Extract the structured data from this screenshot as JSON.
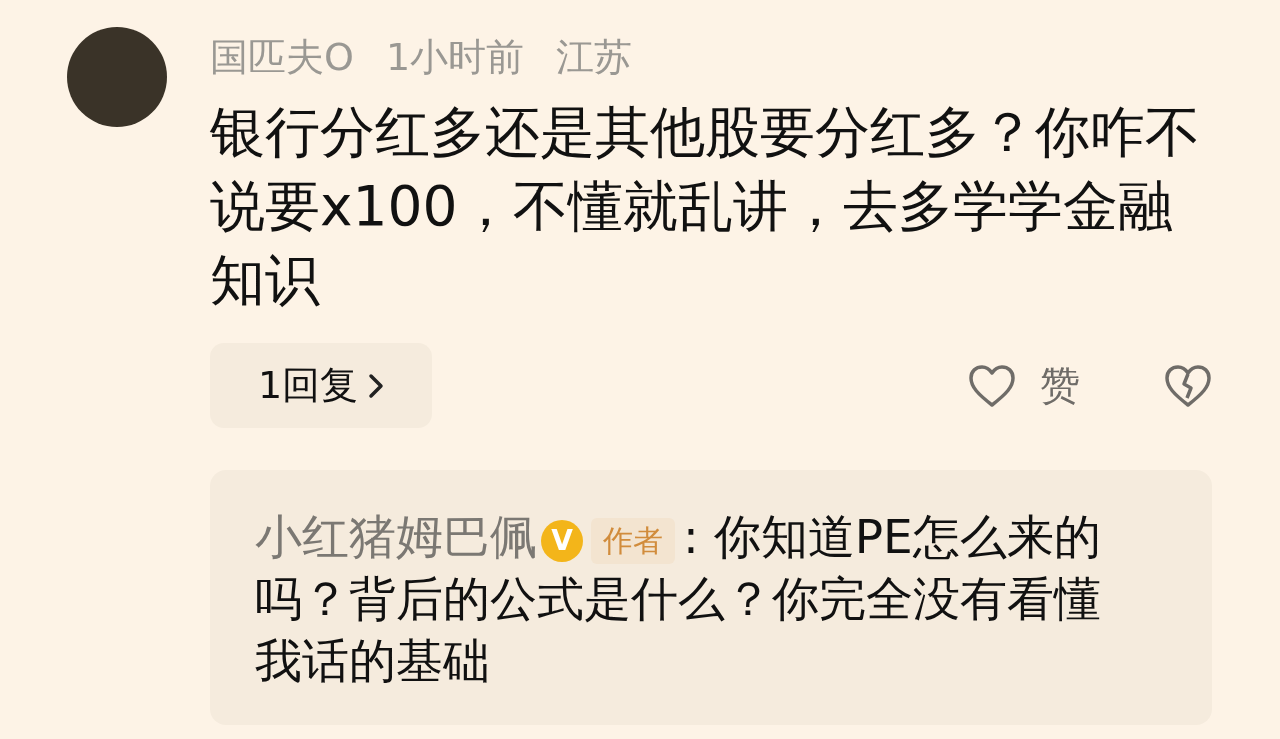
{
  "comment": {
    "username": "国匹夫O",
    "time": "1小时前",
    "location": "江苏",
    "text": "银行分红多还是其他股要分红多？你咋不说要x100，不懂就乱讲，去多学学金融知识",
    "reply_button": "1回复",
    "like_label": "赞"
  },
  "reply": {
    "author": "小红猪姆巴佩",
    "verified_badge": "V",
    "author_tag": "作者",
    "text": ": 你知道PE怎么来的吗？背后的公式是什么？你完全没有看懂我话的基础"
  }
}
